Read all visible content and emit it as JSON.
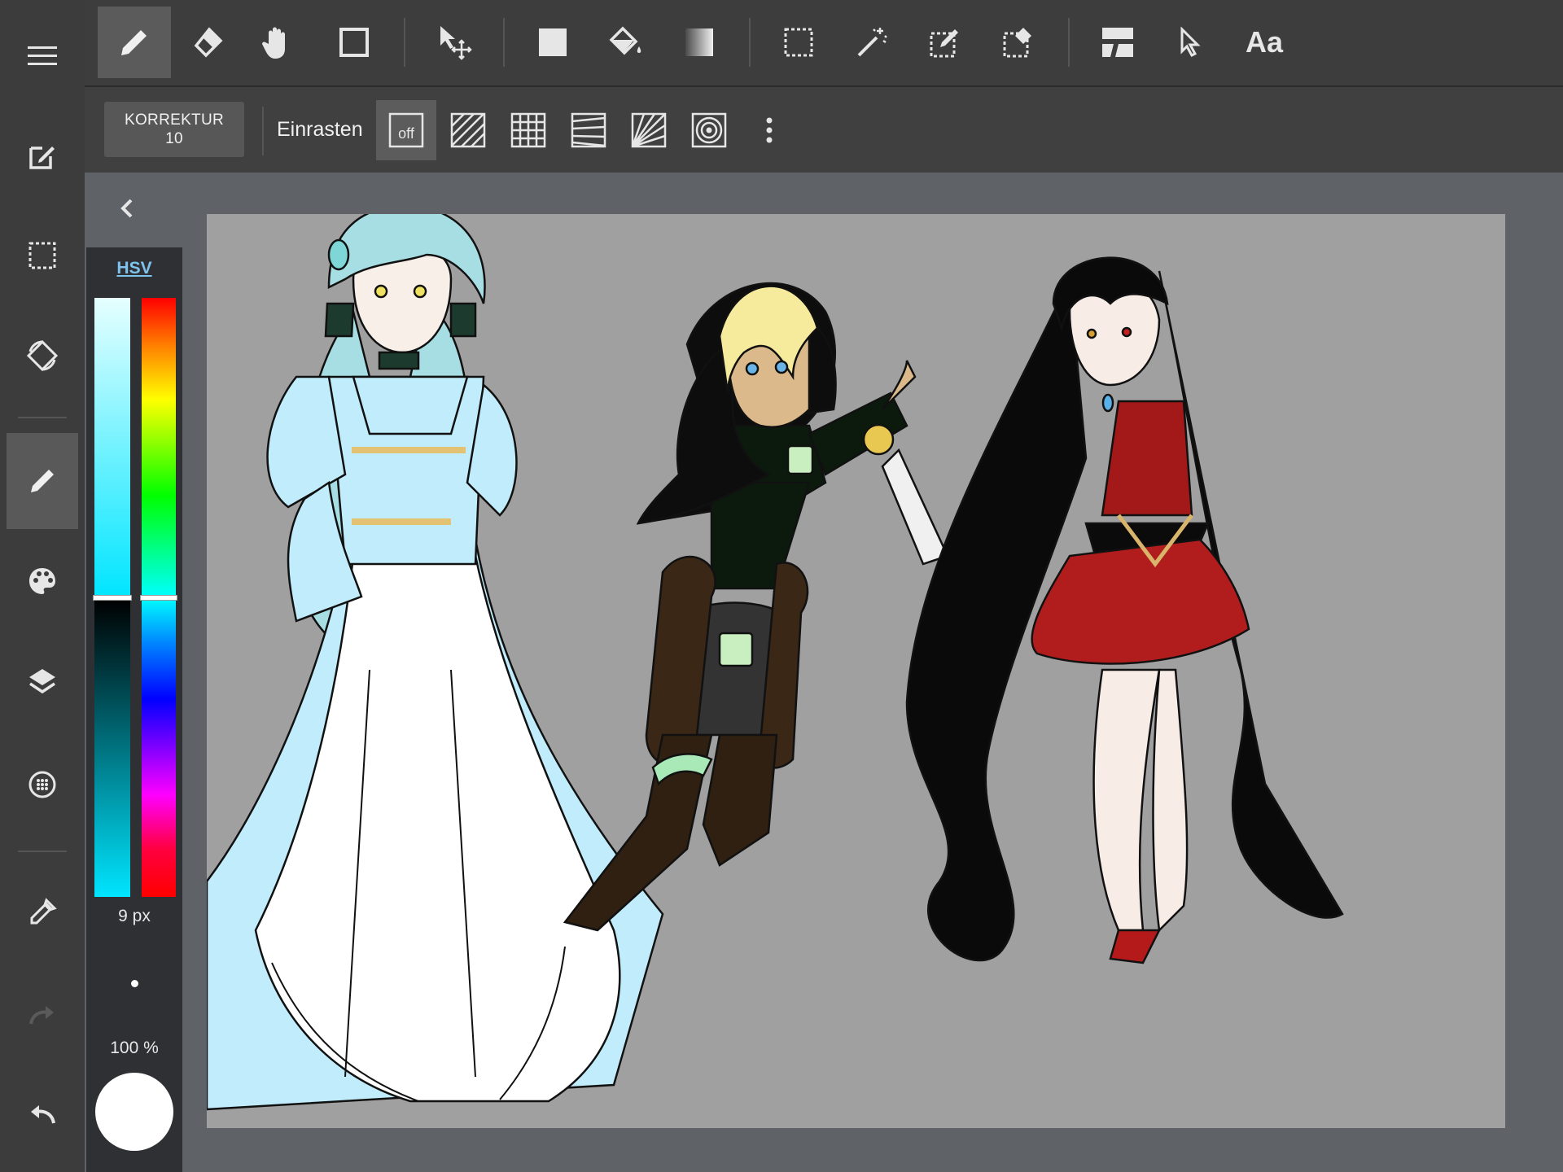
{
  "left_toolbar": {
    "items": [
      {
        "name": "menu",
        "icon": "menu-icon"
      },
      {
        "name": "edit",
        "icon": "edit-box-icon"
      },
      {
        "name": "select",
        "icon": "dashed-select-icon"
      },
      {
        "name": "rotate",
        "icon": "rotate-icon"
      },
      {
        "name": "brush",
        "icon": "pen-icon",
        "active": true
      },
      {
        "name": "color",
        "icon": "palette-icon"
      },
      {
        "name": "layers",
        "icon": "layers-icon"
      },
      {
        "name": "materials",
        "icon": "globe-icon"
      },
      {
        "name": "eyedropper",
        "icon": "eyedropper-icon"
      },
      {
        "name": "redo",
        "icon": "redo-icon"
      },
      {
        "name": "undo",
        "icon": "undo-icon"
      }
    ]
  },
  "top_toolbar": {
    "active_tool": "pen",
    "text_tool_label": "Aa"
  },
  "sub_toolbar": {
    "correction_label": "KORREKTUR",
    "correction_value": "10",
    "snap_label": "Einrasten",
    "snap_off_label": "off"
  },
  "color_panel": {
    "mode_tab": "HSV",
    "value_fraction": 0.5,
    "hue_fraction": 0.5,
    "brush_size": "9 px",
    "opacity": "100 %",
    "current_color": "#ffffff"
  },
  "colors": {
    "toolbar_bg": "#3d3d3d",
    "canvas_bg": "#a0a0a0",
    "workspace_bg": "#5f6267",
    "accent": "#7ec3ee"
  }
}
